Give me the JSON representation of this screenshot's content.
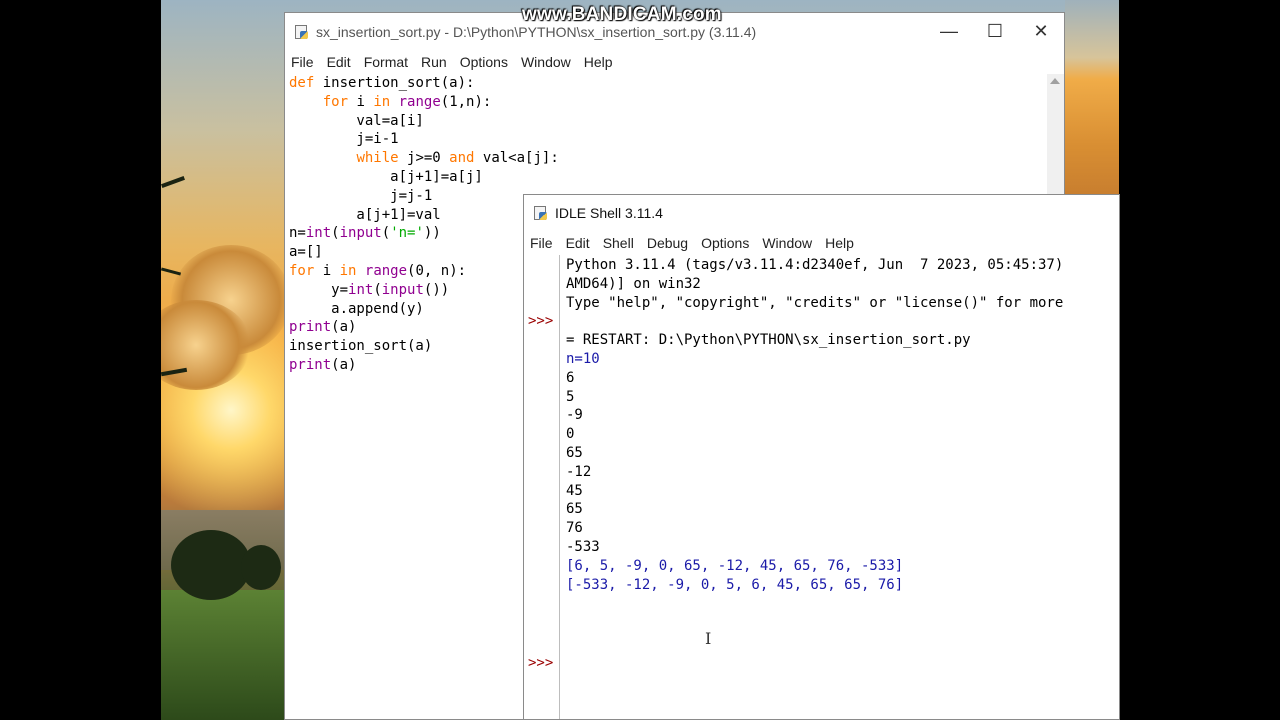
{
  "watermark": "www.BANDICAM.com",
  "editor": {
    "title": "sx_insertion_sort.py - D:\\Python\\PYTHON\\sx_insertion_sort.py (3.11.4)",
    "menu": [
      "File",
      "Edit",
      "Format",
      "Run",
      "Options",
      "Window",
      "Help"
    ],
    "code_lines": [
      "def insertion_sort(a):",
      "    for i in range(1,n):",
      "        val=a[i]",
      "        j=i-1",
      "        while j>=0 and val<a[j]:",
      "            a[j+1]=a[j]",
      "            j=j-1",
      "        a[j+1]=val",
      "n=int(input('n='))",
      "a=[]",
      "for i in range(0, n):",
      "     y=int(input())",
      "     a.append(y)",
      "print(a)",
      "insertion_sort(a)",
      "print(a)"
    ]
  },
  "shell": {
    "title": "IDLE Shell 3.11.4",
    "menu": [
      "File",
      "Edit",
      "Shell",
      "Debug",
      "Options",
      "Window",
      "Help"
    ],
    "prompt": ">>>",
    "banner": [
      "Python 3.11.4 (tags/v3.11.4:d2340ef, Jun  7 2023, 05:45:37)",
      "AMD64)] on win32",
      "Type \"help\", \"copyright\", \"credits\" or \"license()\" for more"
    ],
    "restart": "= RESTART: D:\\Python\\PYTHON\\sx_insertion_sort.py",
    "inputs": [
      "n=10",
      "6",
      "5",
      "-9",
      "0",
      "65",
      "-12",
      "45",
      "65",
      "76",
      "-533"
    ],
    "output_unsorted": "[6, 5, -9, 0, 65, -12, 45, 65, 76, -533]",
    "output_sorted": "[-533, -12, -9, 0, 5, 6, 45, 65, 65, 76]"
  }
}
